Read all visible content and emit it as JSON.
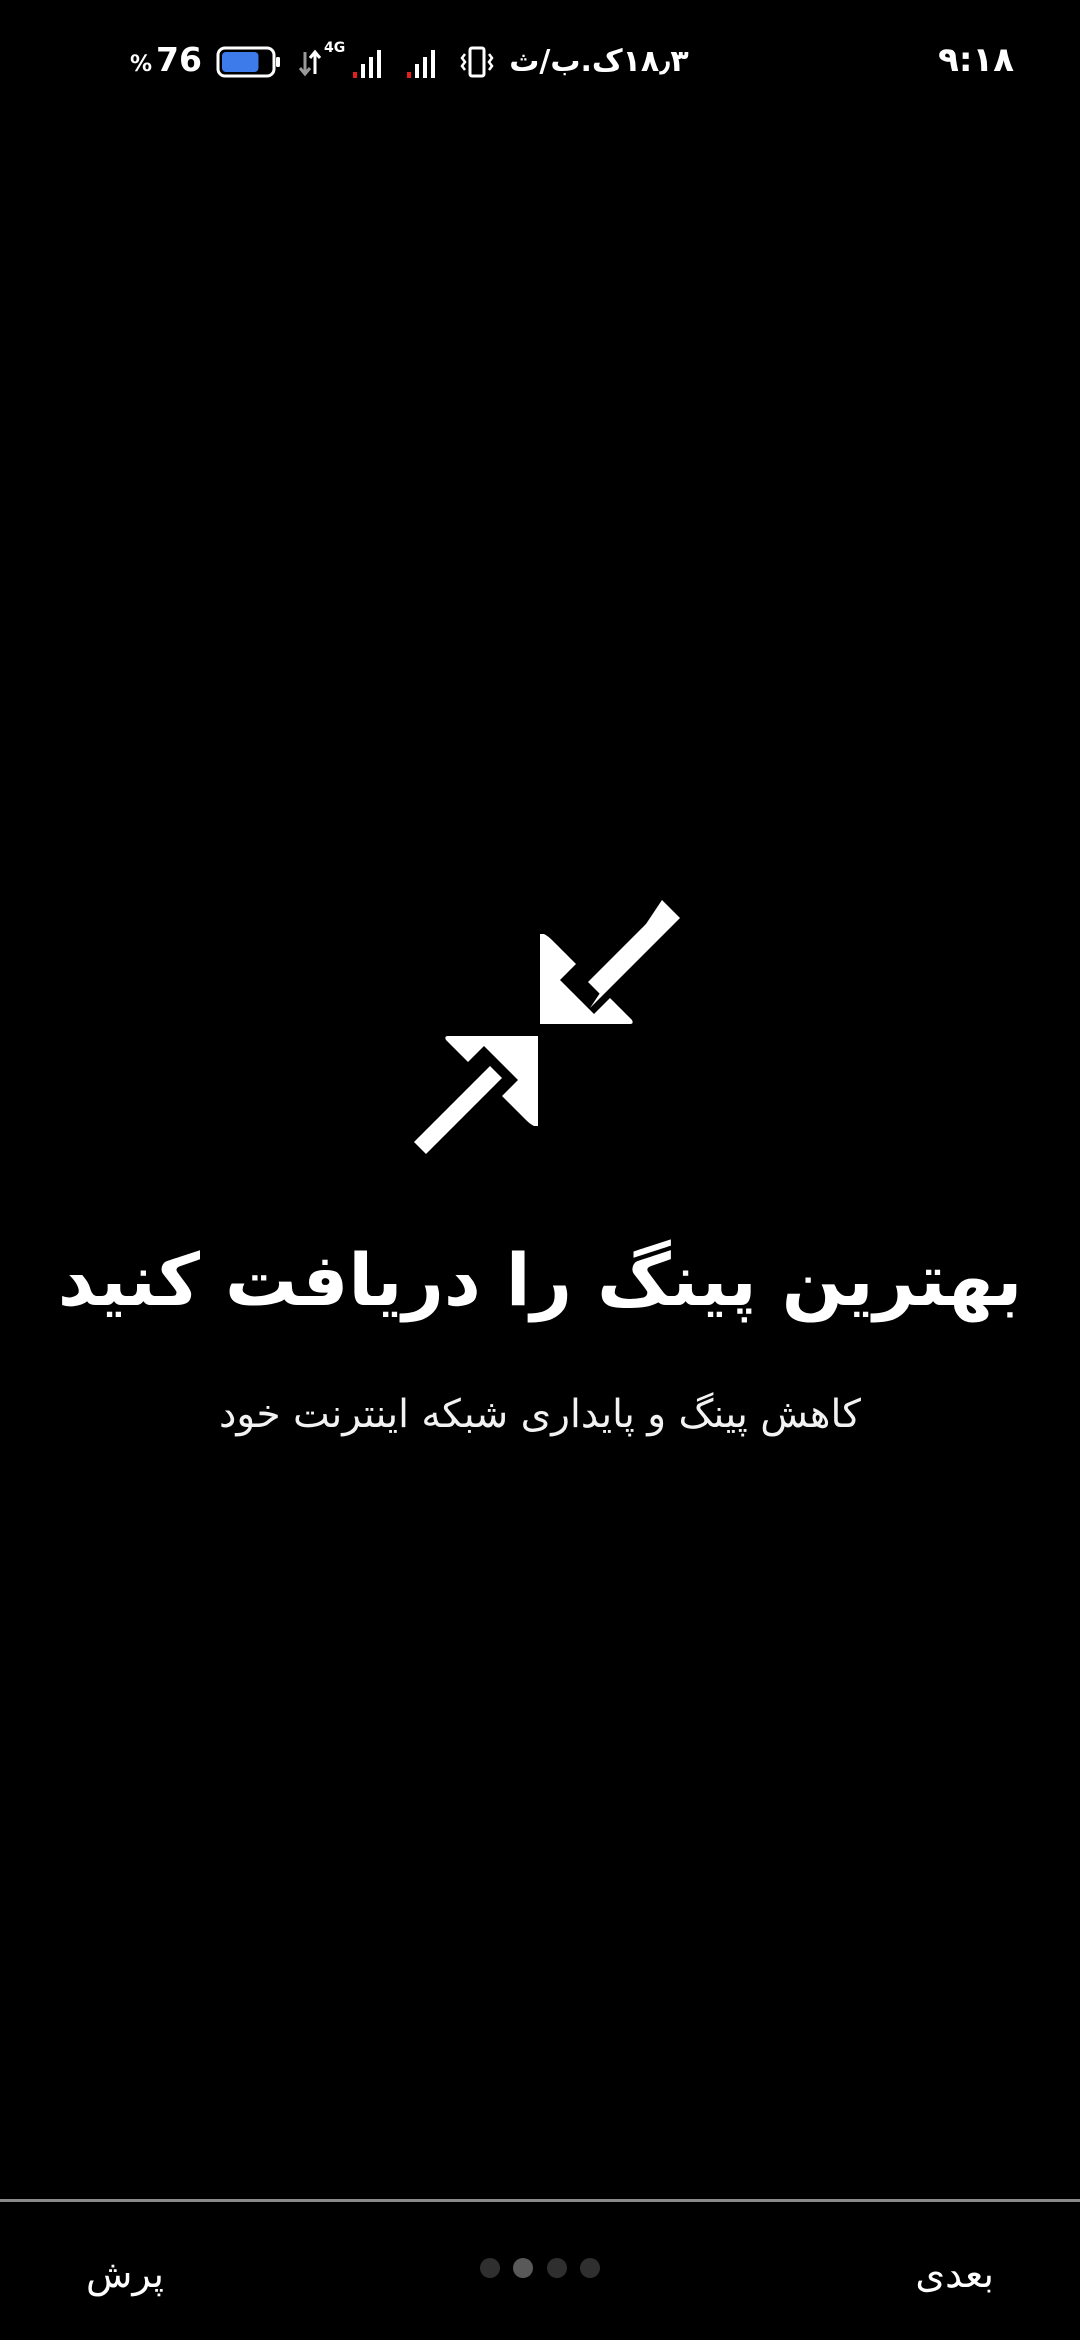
{
  "status_bar": {
    "time": "۹:۱۸",
    "battery_percent": "76",
    "battery_percent_sign": "%",
    "battery_level": 0.76,
    "network_type": "4G",
    "net_speed": "۱۸٫۳ک.ب/ث",
    "icons": [
      "battery-icon",
      "data-arrows-icon",
      "signal-icon",
      "signal-icon",
      "vibrate-icon"
    ]
  },
  "onboarding": {
    "icon": "compress-arrows-icon",
    "title": "بهترین پینگ را دریافت کنید",
    "subtitle": "کاهش پینگ و پایداری شبکه اینترنت خود",
    "page_count": 4,
    "current_page": 2
  },
  "nav": {
    "next_label": "بعدی",
    "skip_label": "پرش"
  },
  "colors": {
    "background": "#000000",
    "foreground": "#ffffff",
    "battery_fill": "#3d7bea",
    "signal_alert": "#e02020",
    "dot_inactive": "#2f2f2f",
    "dot_active": "#595959",
    "divider": "#8a8a8a"
  }
}
